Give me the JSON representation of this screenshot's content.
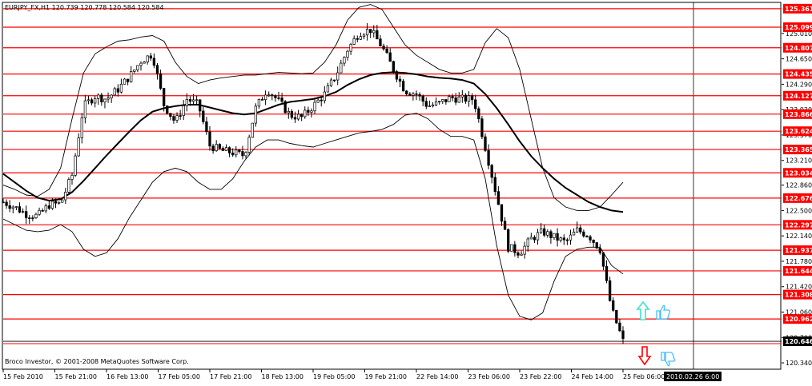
{
  "header": {
    "text": "EURJPY_FX,H1  120.739 120.778 120.584 120.584"
  },
  "footer": {
    "copyright": "Broco Investor, © 2001-2008 MetaQuotes Software Corp.",
    "current_time_label": "2010.02.26 6:00"
  },
  "colors": {
    "level_line": "#ff0000",
    "level_label_bg": "#ff0000",
    "candle": "#000000",
    "bollinger": "#000000",
    "moving_average": "#000000",
    "up_arrow": "#40e0d0",
    "down_arrow": "#ff0000",
    "hand_icon": "#40c0ff"
  },
  "icons": {
    "up_arrow": "up-arrow-icon",
    "down_arrow": "down-arrow-icon",
    "thumbs_up": "thumbs-up-icon",
    "thumbs_down": "thumbs-down-icon"
  },
  "chart_data": {
    "type": "candlestick",
    "symbol": "EURJPY_FX",
    "timeframe": "H1",
    "ohlc_last": {
      "open": 120.739,
      "high": 120.778,
      "low": 120.584,
      "close": 120.584
    },
    "ylim": [
      120.25,
      125.45
    ],
    "y_ticks": [
      "125.010",
      "124.650",
      "124.290",
      "123.930",
      "123.570",
      "123.210",
      "122.860",
      "122.500",
      "122.140",
      "121.780",
      "121.420",
      "121.060",
      "120.700",
      "120.340"
    ],
    "x_ticks": [
      "15 Feb 2010",
      "15 Feb 21:00",
      "16 Feb 13:00",
      "17 Feb 05:00",
      "17 Feb 21:00",
      "18 Feb 13:00",
      "19 Feb 05:00",
      "19 Feb 21:00",
      "22 Feb 14:00",
      "23 Feb 06:00",
      "23 Feb 22:00",
      "24 Feb 14:00",
      "25 Feb 06:00"
    ],
    "levels": [
      {
        "label": "125.361",
        "value": 125.361
      },
      {
        "label": "125.099",
        "value": 125.099
      },
      {
        "label": "124.807",
        "value": 124.807
      },
      {
        "label": "124.435",
        "value": 124.435
      },
      {
        "label": "124.127",
        "value": 124.127
      },
      {
        "label": "123.866",
        "value": 123.866
      },
      {
        "label": "123.624",
        "value": 123.624
      },
      {
        "label": "123.365",
        "value": 123.365
      },
      {
        "label": "123.034",
        "value": 123.034
      },
      {
        "label": "122.676",
        "value": 122.676
      },
      {
        "label": "122.297",
        "value": 122.297
      },
      {
        "label": "121.937",
        "value": 121.937
      },
      {
        "label": "121.644",
        "value": 121.644
      },
      {
        "label": "121.308",
        "value": 121.308
      },
      {
        "label": "120.962",
        "value": 120.962
      }
    ],
    "price_marker": {
      "label": "120.646",
      "value": 120.646
    },
    "close_series": [
      122.62,
      122.55,
      122.45,
      122.42,
      122.58,
      122.6,
      123.0,
      123.98,
      124.12,
      124.08,
      124.22,
      124.4,
      124.62,
      124.72,
      124.0,
      123.75,
      124.08,
      124.0,
      123.42,
      123.35,
      123.32,
      123.28,
      123.95,
      124.22,
      124.05,
      123.85,
      123.82,
      123.98,
      124.15,
      124.42,
      124.78,
      125.02,
      125.06,
      124.82,
      124.5,
      124.2,
      124.15,
      123.98,
      124.02,
      124.1,
      124.08,
      124.08,
      123.4,
      122.7,
      121.98,
      121.9,
      122.1,
      122.2,
      122.12,
      122.05,
      122.22,
      122.15,
      121.95,
      121.1,
      120.65
    ],
    "ma_series": [
      123.02,
      122.9,
      122.78,
      122.68,
      122.64,
      122.66,
      122.76,
      122.92,
      123.1,
      123.28,
      123.45,
      123.62,
      123.78,
      123.9,
      123.95,
      123.98,
      124.0,
      124.0,
      123.96,
      123.92,
      123.88,
      123.86,
      123.88,
      123.94,
      124.0,
      124.04,
      124.06,
      124.08,
      124.12,
      124.18,
      124.28,
      124.36,
      124.42,
      124.45,
      124.46,
      124.45,
      124.43,
      124.4,
      124.38,
      124.37,
      124.35,
      124.3,
      124.15,
      123.95,
      123.72,
      123.48,
      123.27,
      123.1,
      122.95,
      122.82,
      122.72,
      122.62,
      122.55,
      122.5,
      122.48
    ],
    "bb_upper": [
      122.86,
      122.8,
      122.72,
      122.7,
      122.8,
      123.1,
      123.8,
      124.45,
      124.72,
      124.82,
      124.9,
      124.92,
      124.96,
      124.98,
      124.9,
      124.6,
      124.4,
      124.3,
      124.35,
      124.38,
      124.4,
      124.42,
      124.42,
      124.44,
      124.46,
      124.45,
      124.44,
      124.45,
      124.6,
      124.85,
      125.2,
      125.38,
      125.42,
      125.35,
      125.1,
      124.85,
      124.7,
      124.6,
      124.5,
      124.45,
      124.45,
      124.5,
      124.88,
      125.08,
      124.95,
      124.5,
      123.8,
      123.1,
      122.68,
      122.55,
      122.5,
      122.5,
      122.55,
      122.72,
      122.9
    ],
    "bb_lower": [
      122.38,
      122.3,
      122.22,
      122.2,
      122.22,
      122.3,
      122.2,
      121.95,
      121.85,
      121.9,
      122.1,
      122.4,
      122.65,
      122.9,
      123.05,
      123.1,
      123.05,
      122.9,
      122.8,
      122.8,
      122.95,
      123.2,
      123.4,
      123.5,
      123.5,
      123.45,
      123.42,
      123.4,
      123.45,
      123.5,
      123.55,
      123.6,
      123.62,
      123.65,
      123.72,
      123.85,
      123.88,
      123.8,
      123.65,
      123.55,
      123.55,
      123.5,
      122.95,
      122.0,
      121.3,
      121.0,
      120.95,
      121.05,
      121.5,
      121.85,
      121.95,
      121.98,
      121.98,
      121.72,
      121.6
    ]
  }
}
